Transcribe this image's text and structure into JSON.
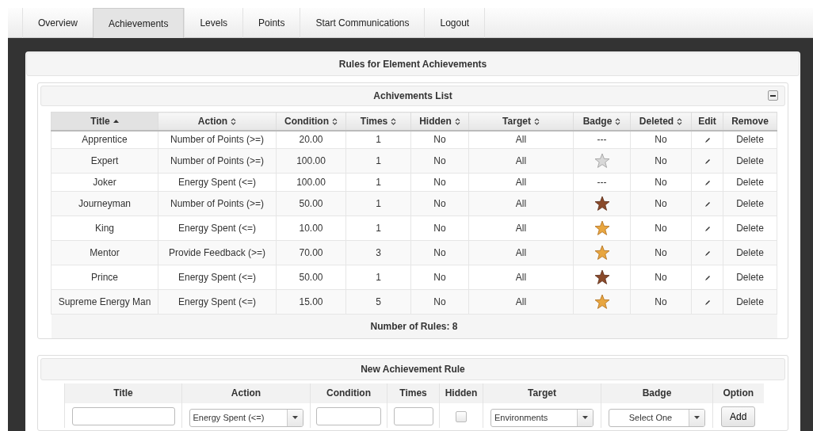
{
  "nav": {
    "tabs": [
      {
        "label": "Overview",
        "selected": false
      },
      {
        "label": "Achievements",
        "selected": true
      },
      {
        "label": "Levels",
        "selected": false
      },
      {
        "label": "Points",
        "selected": false
      },
      {
        "label": "Start Communications",
        "selected": false
      },
      {
        "label": "Logout",
        "selected": false
      }
    ]
  },
  "panel": {
    "title": "Rules for Element Achievements",
    "list": {
      "title": "Achivements List",
      "expanded": true,
      "columns": [
        {
          "label": "Title",
          "sortable": true,
          "sorted": true
        },
        {
          "label": "Action",
          "sortable": true,
          "sorted": false
        },
        {
          "label": "Condition",
          "sortable": true,
          "sorted": false
        },
        {
          "label": "Times",
          "sortable": true,
          "sorted": false
        },
        {
          "label": "Hidden",
          "sortable": true,
          "sorted": false
        },
        {
          "label": "Target",
          "sortable": true,
          "sorted": false
        },
        {
          "label": "Badge",
          "sortable": true,
          "sorted": false
        },
        {
          "label": "Deleted",
          "sortable": true,
          "sorted": false
        },
        {
          "label": "Edit",
          "sortable": false,
          "sorted": false
        },
        {
          "label": "Remove",
          "sortable": false,
          "sorted": false
        }
      ],
      "rows": [
        {
          "title": "Apprentice",
          "action": "Number of Points (>=)",
          "condition": "20.00",
          "times": "1",
          "hidden": "No",
          "target": "All",
          "badge": {
            "kind": "none",
            "text": "---"
          },
          "deleted": "No",
          "remove": "Delete"
        },
        {
          "title": "Expert",
          "action": "Number of Points (>=)",
          "condition": "100.00",
          "times": "1",
          "hidden": "No",
          "target": "All",
          "badge": {
            "kind": "silver"
          },
          "deleted": "No",
          "remove": "Delete"
        },
        {
          "title": "Joker",
          "action": "Energy Spent (<=)",
          "condition": "100.00",
          "times": "1",
          "hidden": "No",
          "target": "All",
          "badge": {
            "kind": "none",
            "text": "---"
          },
          "deleted": "No",
          "remove": "Delete"
        },
        {
          "title": "Journeyman",
          "action": "Number of Points (>=)",
          "condition": "50.00",
          "times": "1",
          "hidden": "No",
          "target": "All",
          "badge": {
            "kind": "bronze"
          },
          "deleted": "No",
          "remove": "Delete"
        },
        {
          "title": "King",
          "action": "Energy Spent (<=)",
          "condition": "10.00",
          "times": "1",
          "hidden": "No",
          "target": "All",
          "badge": {
            "kind": "gold"
          },
          "deleted": "No",
          "remove": "Delete"
        },
        {
          "title": "Mentor",
          "action": "Provide Feedback (>=)",
          "condition": "70.00",
          "times": "3",
          "hidden": "No",
          "target": "All",
          "badge": {
            "kind": "gold"
          },
          "deleted": "No",
          "remove": "Delete"
        },
        {
          "title": "Prince",
          "action": "Energy Spent (<=)",
          "condition": "50.00",
          "times": "1",
          "hidden": "No",
          "target": "All",
          "badge": {
            "kind": "bronze"
          },
          "deleted": "No",
          "remove": "Delete"
        },
        {
          "title": "Supreme Energy Man",
          "action": "Energy Spent (<=)",
          "condition": "15.00",
          "times": "5",
          "hidden": "No",
          "target": "All",
          "badge": {
            "kind": "gold"
          },
          "deleted": "No",
          "remove": "Delete"
        }
      ],
      "footer": "Number of Rules: 8"
    }
  },
  "new_rule": {
    "title": "New Achievement Rule",
    "columns": [
      "Title",
      "Action",
      "Condition",
      "Times",
      "Hidden",
      "Target",
      "Badge",
      "Option"
    ],
    "action": {
      "value": "Energy Spent (<=)"
    },
    "hidden": {
      "checked": false
    },
    "target": {
      "value": "Environments"
    },
    "badge": {
      "value": "Select One"
    },
    "add_button": "Add"
  }
}
